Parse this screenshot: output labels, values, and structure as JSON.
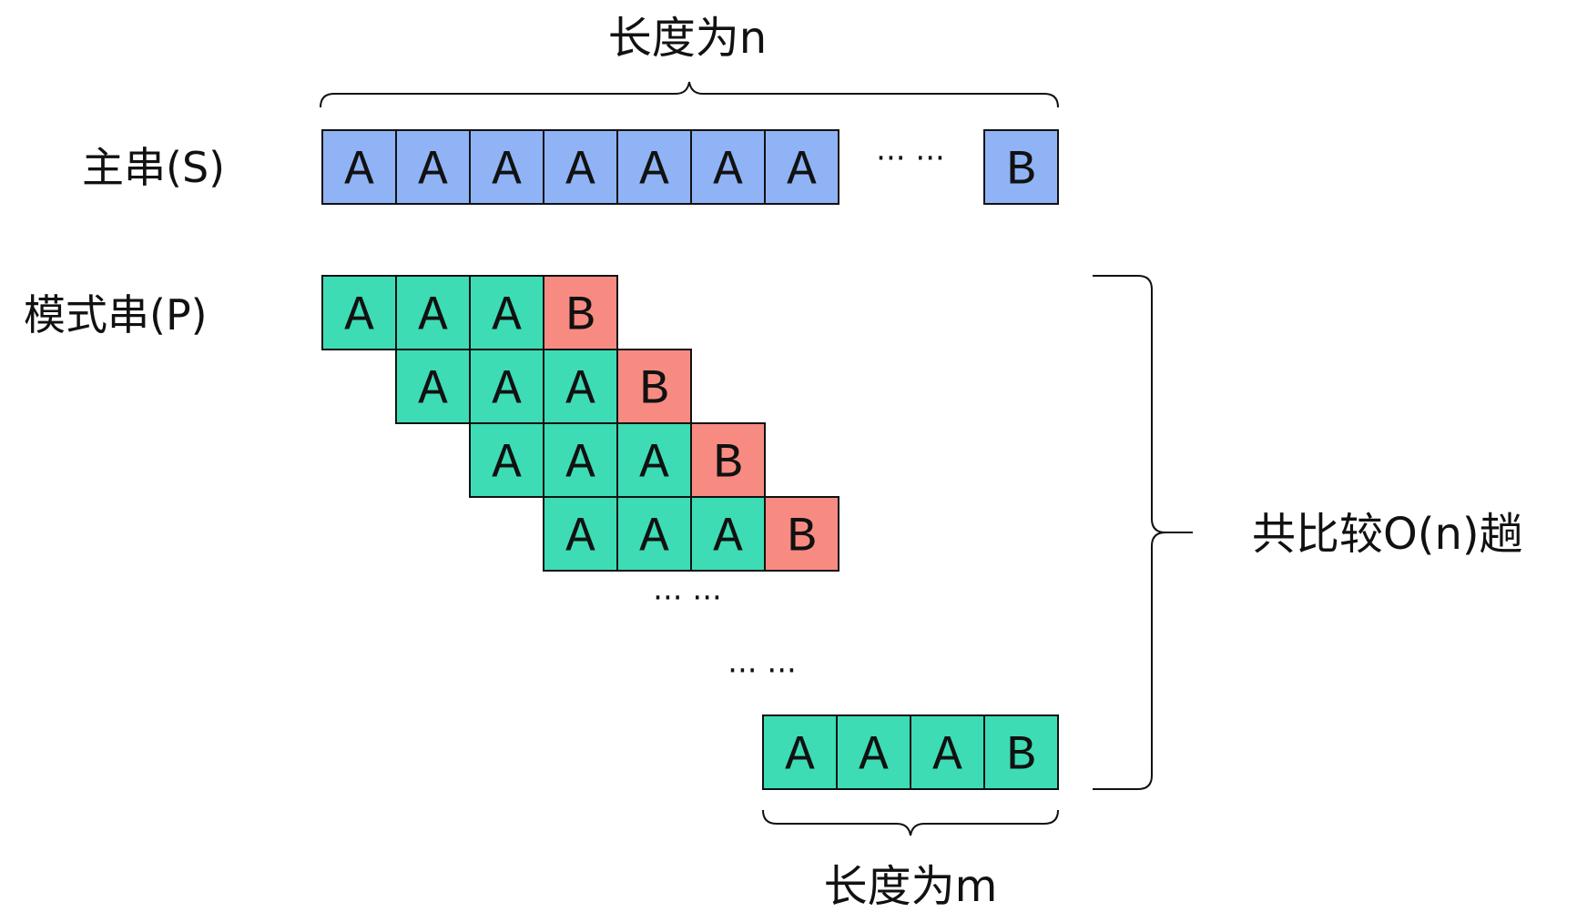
{
  "labels": {
    "top_length": "长度为n",
    "main_string": "主串(S)",
    "pattern_string": "模式串(P)",
    "total_compare": "共比较O(n)趟",
    "bottom_length": "长度为m"
  },
  "main_string": {
    "cells_before_gap": [
      "A",
      "A",
      "A",
      "A",
      "A",
      "A",
      "A"
    ],
    "gap": "··· ···",
    "cells_after_gap": [
      "B"
    ]
  },
  "pattern_rows": [
    [
      "A",
      "A",
      "A",
      "B"
    ],
    [
      "A",
      "A",
      "A",
      "B"
    ],
    [
      "A",
      "A",
      "A",
      "B"
    ],
    [
      "A",
      "A",
      "A",
      "B"
    ]
  ],
  "ellipsis_rows": [
    "··· ···",
    "··· ···"
  ],
  "final_pattern_row": [
    "A",
    "A",
    "A",
    "B"
  ],
  "colors": {
    "main_cell": "#8fb3f5",
    "match_cell": "#3ddcb5",
    "mismatch_cell": "#f78b82",
    "stroke": "#111111"
  }
}
